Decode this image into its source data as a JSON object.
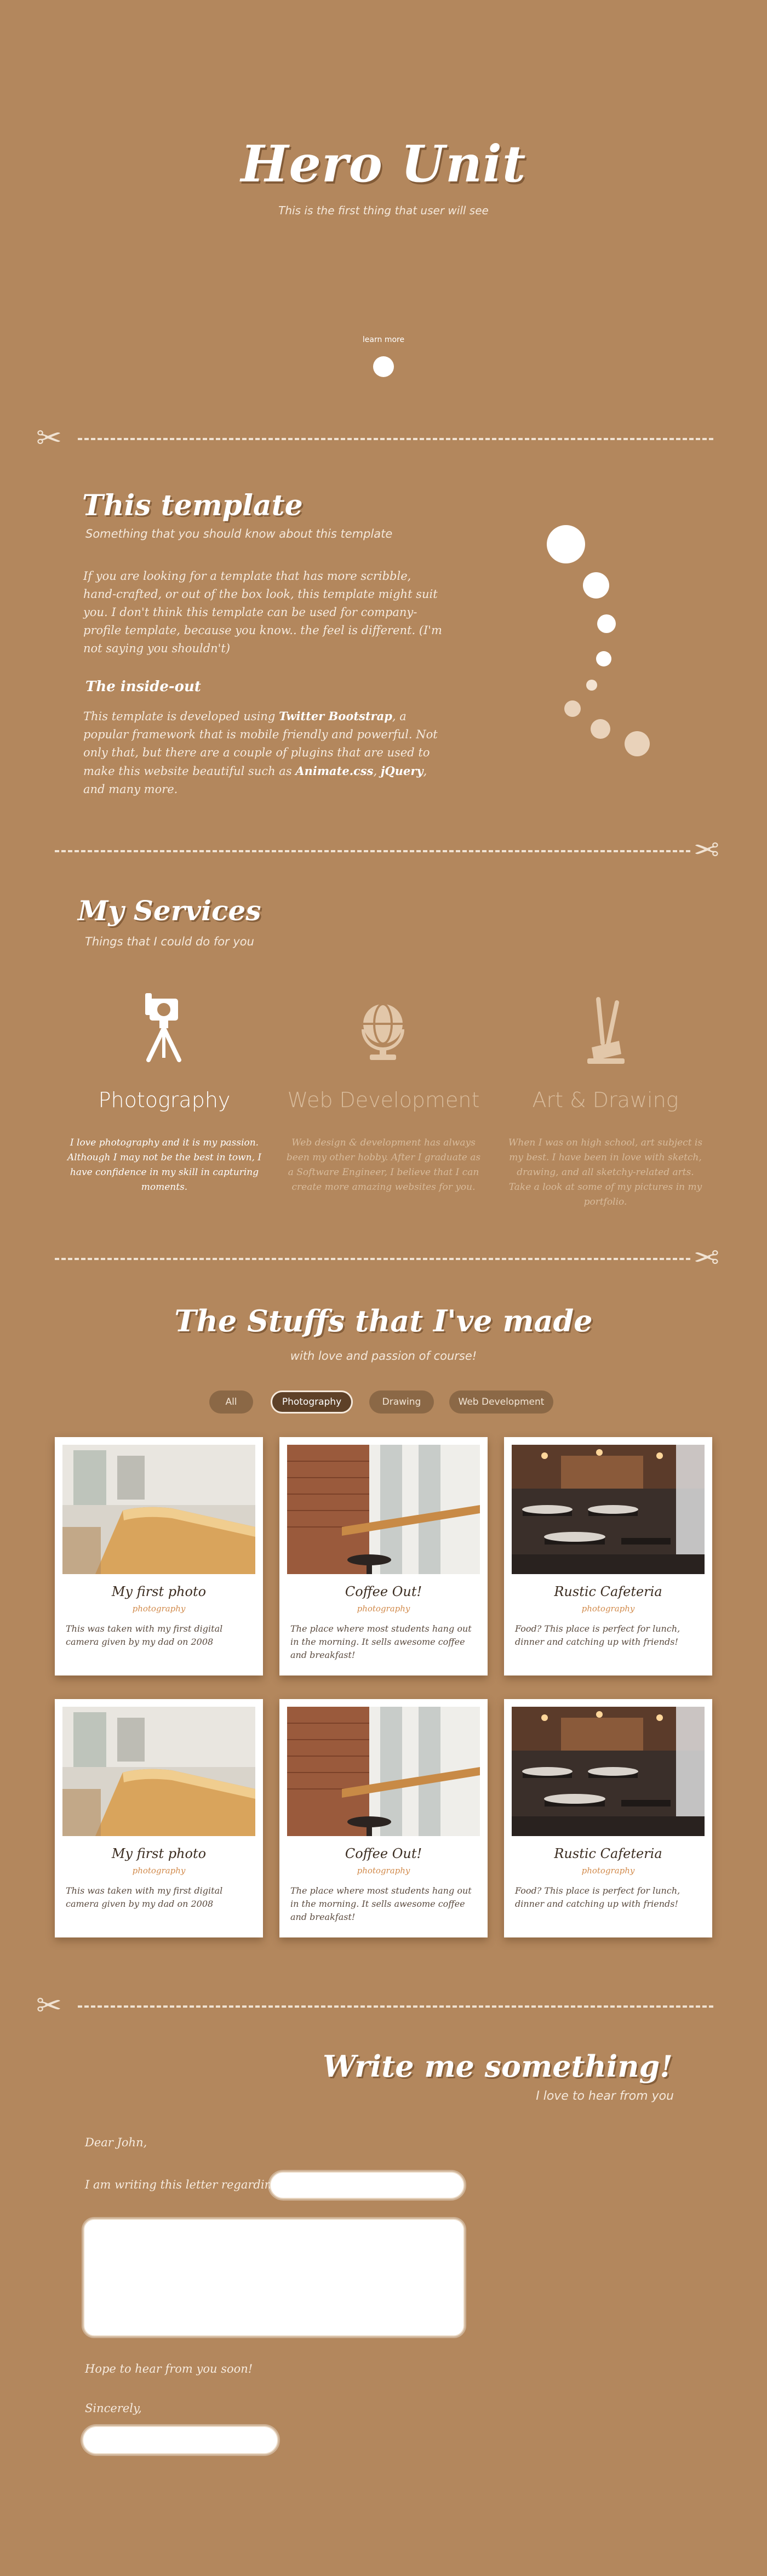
{
  "hero": {
    "title": "Hero Unit",
    "subtitle": "This is the first thing that user will see",
    "learn_more": "learn more"
  },
  "template_section": {
    "title": "This template",
    "subtitle": "Something that you should know about this template",
    "paragraph": "If you are looking for a template that has more scribble, hand-crafted, or out of the box look, this template might suit you. I don't think this template can be used for company-profile template, because you know.. the feel is different. (I'm not saying you shouldn't)",
    "inside_title": "The inside-out",
    "inside_pre": "This template is developed using ",
    "inside_bootstrap": "Twitter Bootstrap",
    "inside_mid": ", a popular framework that is mobile friendly and powerful. Not only that, but there are a couple of plugins that are used to make this website beautiful such as ",
    "inside_animate": "Animate.css",
    "inside_comma": ", ",
    "inside_jquery": "jQuery",
    "inside_end": ", and many more."
  },
  "services": {
    "title": "My Services",
    "subtitle": "Things that I could do for you",
    "items": [
      {
        "name": "Photography",
        "icon": "camera-tripod-icon",
        "desc": "I love photography and it is my passion. Although I may not be the best in town, I have confidence in my skill in capturing moments."
      },
      {
        "name": "Web Development",
        "icon": "globe-icon",
        "desc": "Web design & development has always been my other hobby. After I graduate as a Software Engineer, I believe that I can create more amazing websites for you."
      },
      {
        "name": "Art & Drawing",
        "icon": "pencil-cup-icon",
        "desc": "When I was on high school, art subject is my best. I have been in love with sketch, drawing, and all sketchy-related arts. Take a look at some of my pictures in my portfolio."
      }
    ]
  },
  "portfolio": {
    "title": "The Stuffs that I've made",
    "subtitle": "with love and passion of course!",
    "filters": [
      "All",
      "Photography",
      "Drawing",
      "Web Development"
    ],
    "active_filter": "Photography",
    "cards": [
      {
        "title": "My first photo",
        "category": "photography",
        "desc": "This was taken with my first digital camera given by my dad on 2008"
      },
      {
        "title": "Coffee Out!",
        "category": "photography",
        "desc": "The place where most students hang out in the morning. It sells awesome coffee and breakfast!"
      },
      {
        "title": "Rustic Cafeteria",
        "category": "photography",
        "desc": "Food? This place is perfect for lunch, dinner and catching up with friends!"
      },
      {
        "title": "My first photo",
        "category": "photography",
        "desc": "This was taken with my first digital camera given by my dad on 2008"
      },
      {
        "title": "Coffee Out!",
        "category": "photography",
        "desc": "The place where most students hang out in the morning. It sells awesome coffee and breakfast!"
      },
      {
        "title": "Rustic Cafeteria",
        "category": "photography",
        "desc": "Food? This place is perfect for lunch, dinner and catching up with friends!"
      }
    ]
  },
  "contact": {
    "title": "Write me something!",
    "subtitle": "I love to hear from you",
    "greeting": "Dear John,",
    "regarding": "I am writing this letter regarding",
    "regarding_value": "",
    "message_value": "",
    "closing": "Hope to hear from you soon!",
    "sincerely": "Sincerely,",
    "name_value": ""
  }
}
